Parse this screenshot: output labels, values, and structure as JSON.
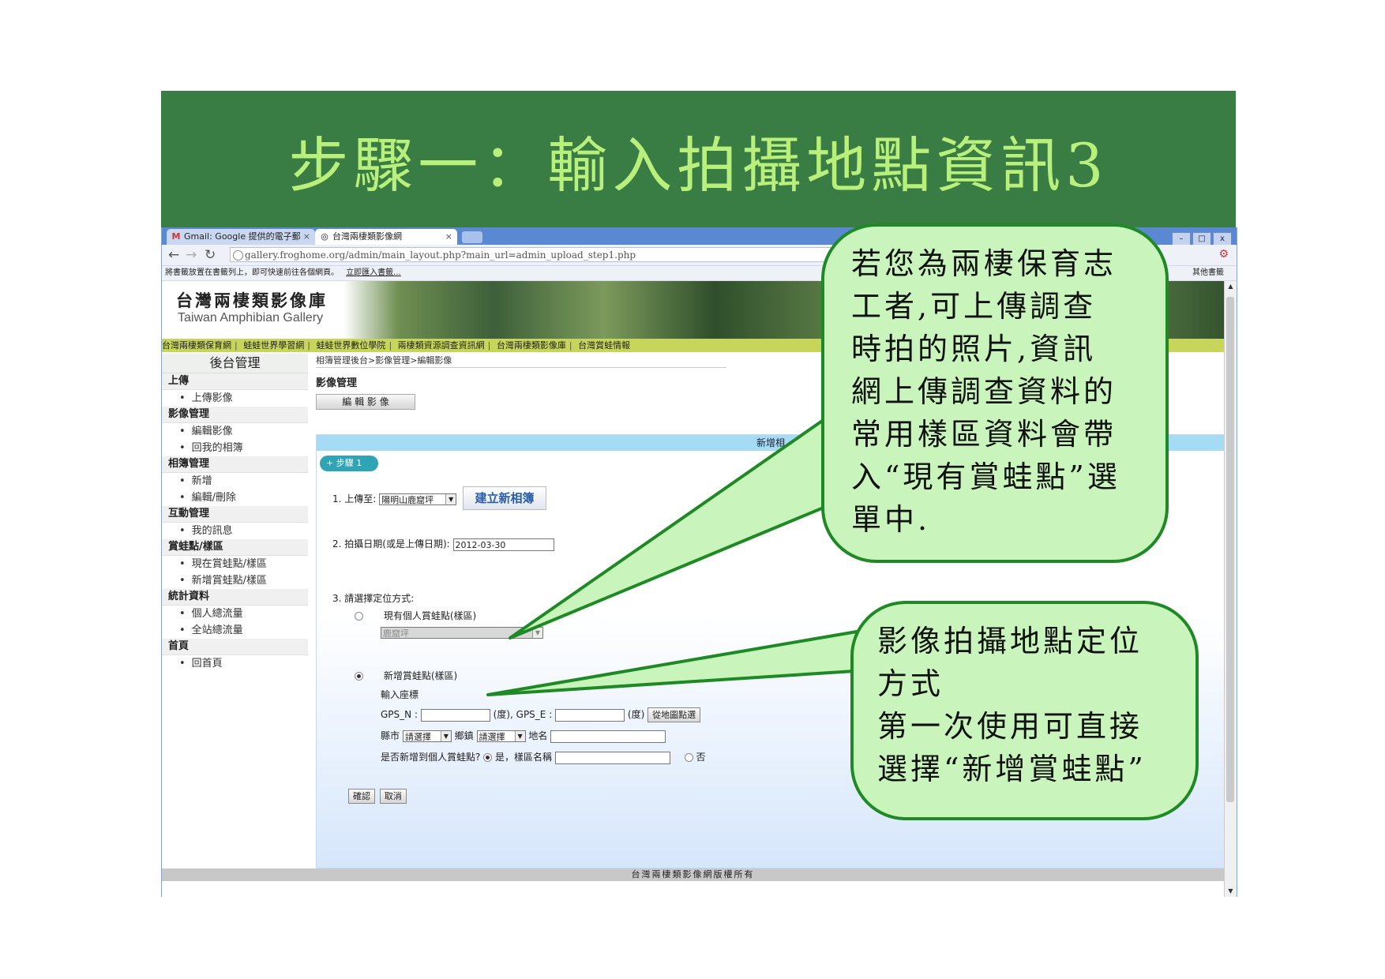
{
  "slide": {
    "title": "步驟一：輸入拍攝地點資訊3"
  },
  "browser": {
    "tabs": [
      {
        "label": "Gmail: Google 提供的電子郵",
        "icon": "gmail-icon"
      },
      {
        "label": "台灣兩棲類影像網",
        "icon": "globe-icon"
      }
    ],
    "url": "gallery.froghome.org/admin/main_layout.php?main_url=admin_upload_step1.php",
    "bookmarks_hint": "將書籤放置在書籤列上，即可快速前往各個網頁。",
    "bookmarks_import": "立即匯入書籤...",
    "bookmarks_other": "其他書籤"
  },
  "site": {
    "logo_cn": "台灣兩棲類影像庫",
    "logo_en": "Taiwan Amphibian Gallery",
    "links": [
      "台灣兩棲類保育網",
      "蛙蛙世界學習網",
      "蛙蛙世界數位學院",
      "兩棲類資源調查資訊網",
      "台灣兩棲類影像庫",
      "台灣賞蛙情報"
    ],
    "footer": "台灣兩棲類影像網版權所有"
  },
  "sidebar": {
    "title": "後台管理",
    "sections": [
      {
        "label": "上傳",
        "items": [
          "上傳影像"
        ]
      },
      {
        "label": "影像管理",
        "items": [
          "編輯影像",
          "回我的相簿"
        ]
      },
      {
        "label": "相簿管理",
        "items": [
          "新增",
          "編輯/刪除"
        ]
      },
      {
        "label": "互動管理",
        "items": [
          "我的訊息"
        ]
      },
      {
        "label": "賞蛙點/樣區",
        "items": [
          "現在賞蛙點/樣區",
          "新增賞蛙點/樣區"
        ]
      },
      {
        "label": "統計資料",
        "items": [
          "個人總流量",
          "全站總流量"
        ]
      },
      {
        "label": "首頁",
        "items": [
          "回首頁"
        ]
      }
    ]
  },
  "main": {
    "breadcrumb": "相簿管理後台>影像管理>編輯影像",
    "section_title": "影像管理",
    "edit_button": "編 輯 影 像",
    "panel_header": "新增相",
    "step_badge": "步驟 1",
    "upload_to_label": "1. 上傳至:",
    "upload_to_value": "陽明山鹿窟坪",
    "new_album_button": "建立新相簿",
    "date_label": "2. 拍攝日期(或是上傳日期):",
    "date_value": "2012-03-30",
    "locate_label": "3. 請選擇定位方式:",
    "existing_point_label": "現有個人賞蛙點(樣區)",
    "existing_point_value": "鹿窟坪",
    "new_point_label": "新增賞蛙點(樣區)",
    "coords_label": "輸入座標",
    "gps_n_label": "GPS_N :",
    "gps_n_unit": "(度), GPS_E :",
    "gps_e_unit": "(度)",
    "map_button": "從地圖點選",
    "county_label": "縣市",
    "county_value": "請選擇",
    "township_label": "鄉鎮",
    "township_value": "請選擇",
    "place_label": "地名",
    "save_question": "是否新增到個人賞蛙點?",
    "yes_label": "是，樣區名稱",
    "no_label": "否",
    "confirm_button": "確認",
    "cancel_button": "取消"
  },
  "callouts": [
    {
      "lines": [
        "若您為兩棲保育志",
        "工者,可上傳調查",
        "時拍的照片,資訊",
        "網上傳調查資料的",
        "常用樣區資料會帶",
        "入“現有賞蛙點”選",
        "單中."
      ]
    },
    {
      "lines": [
        "影像拍攝地點定位",
        "方式",
        "第一次使用可直接",
        "選擇“新增賞蛙點”"
      ]
    }
  ],
  "colors": {
    "title_bg": "#3a7d44",
    "title_text": "#b9f07b",
    "callout_fill": "#c9f5bd",
    "callout_border": "#1f8a25"
  }
}
